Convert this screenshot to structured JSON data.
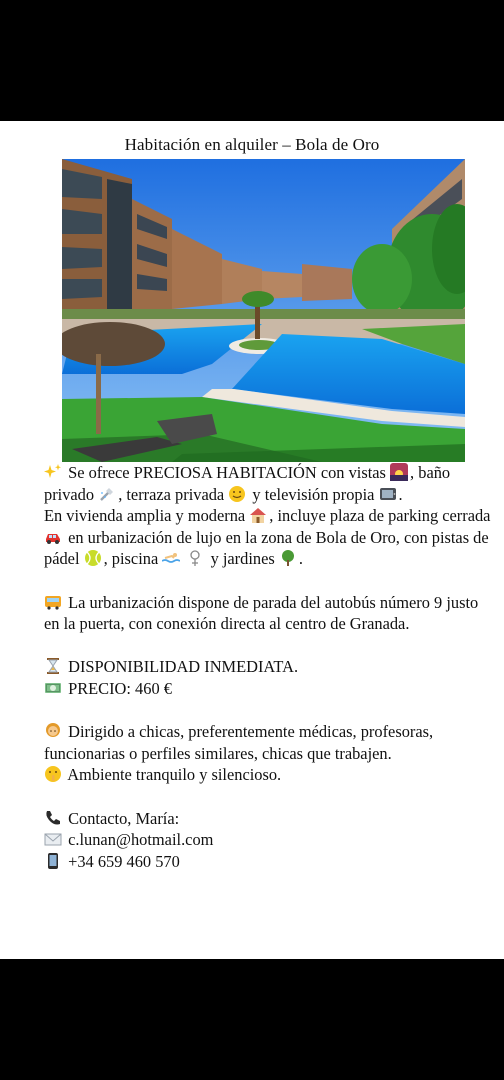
{
  "title": "Habitación en alquiler – Bola de Oro",
  "photo": {
    "icon": "apartment-pool-photo"
  },
  "p1": {
    "a": "Se ofrece PRECIOSA HABITACIÓN con vistas",
    "b": ",",
    "c": "baño privado",
    "d": ", terraza privada",
    "e": "y televisión propia",
    "f": "."
  },
  "p2": {
    "a": "En vivienda amplia y moderna",
    "b": ", incluye plaza de parking cerrada",
    "c": "en urbanización de lujo en la zona de Bola de Oro, con pistas de pádel",
    "d": ", piscina",
    "e": "y jardines",
    "f": "."
  },
  "p3": {
    "a": "La urbanización dispone de parada del autobús número 9 justo en la puerta, con conexión directa al centro de Granada."
  },
  "availability": "DISPONIBILIDAD INMEDIATA.",
  "price": "PRECIO: 460 €",
  "p4": {
    "a": "Dirigido a chicas, preferentemente médicas, profesoras, funcionarias o perfiles similares, chicas que trabajen.",
    "b": "Ambiente tranquilo y silencioso."
  },
  "contact": {
    "name": "Contacto, María:",
    "email": "c.lunan@hotmail.com",
    "phone": "+34 659 460 570"
  }
}
